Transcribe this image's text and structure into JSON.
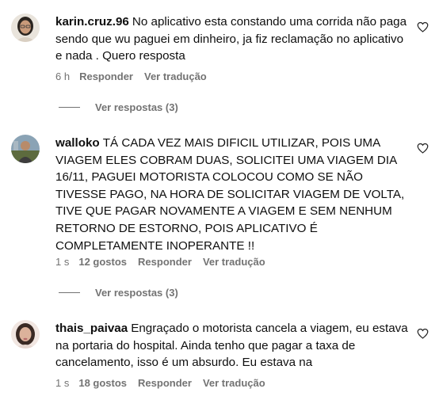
{
  "comments": [
    {
      "username": "karin.cruz.96",
      "text": "No aplicativo esta constando uma corrida não paga sendo que wu paguei em dinheiro, ja fiz reclamação no aplicativo e nada . Quero resposta",
      "time": "6 h",
      "likes": "",
      "reply_label": "Responder",
      "translate_label": "Ver tradução",
      "view_replies_label": "Ver respostas (3)",
      "avatar_icon": "avatar-woman-glasses"
    },
    {
      "username": "walloko",
      "text": "TÁ CADA VEZ MAIS DIFICIL UTILIZAR, POIS UMA VIAGEM ELES COBRAM DUAS, SOLICITEI UMA VIAGEM DIA 16/11, PAGUEI MOTORISTA COLOCOU COMO SE NÃO TIVESSE PAGO, NA HORA DE SOLICITAR VIAGEM DE VOLTA, TIVE QUE PAGAR NOVAMENTE A VIAGEM E SEM NENHUM RETORNO DE ESTORNO, POIS APLICATIVO É COMPLETAMENTE INOPERANTE !!",
      "time": "1 s",
      "likes": "12 gostos",
      "reply_label": "Responder",
      "translate_label": "Ver tradução",
      "view_replies_label": "Ver respostas (3)",
      "avatar_icon": "avatar-man-outdoor"
    },
    {
      "username": "thais_paivaa",
      "text": "Engraçado o motorista cancela a viagem, eu estava na portaria do hospital. Ainda tenho que pagar a taxa de cancelamento, isso é um absurdo. Eu estava na",
      "time": "1 s",
      "likes": "18 gostos",
      "reply_label": "Responder",
      "translate_label": "Ver tradução",
      "avatar_icon": "avatar-woman"
    }
  ],
  "colors": {
    "text": "#0f0f0f",
    "secondary": "#737373",
    "background": "#ffffff"
  },
  "icons": {
    "like": "heart-outline-icon"
  }
}
